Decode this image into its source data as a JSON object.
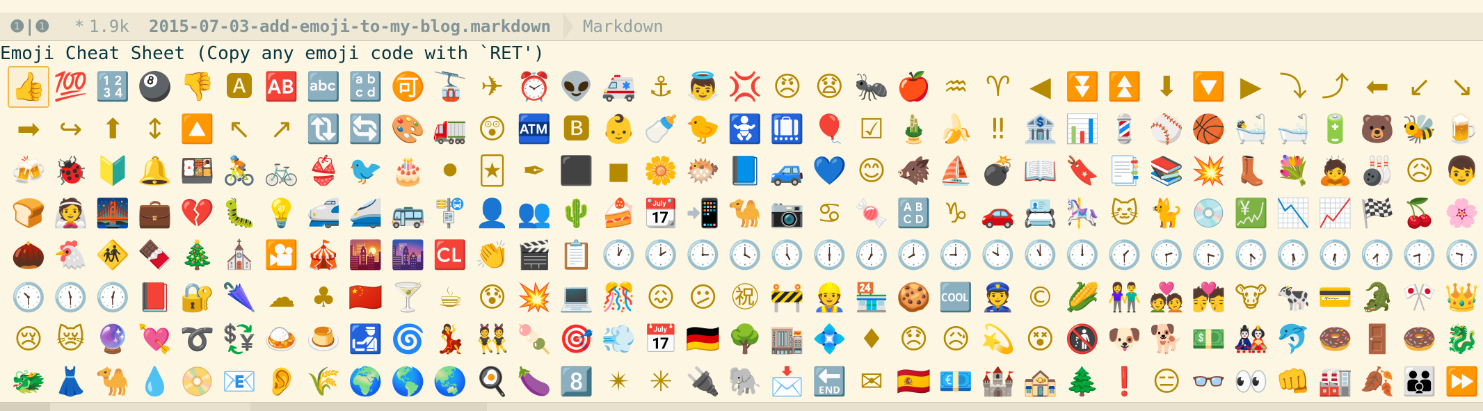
{
  "modeline": {
    "window_numbers": "❶|❶",
    "modified": "*",
    "size": "1.9k",
    "filename": "2015-07-03-add-emoji-to-my-blog.markdown",
    "major_mode": "Markdown"
  },
  "buffer": {
    "title": "Emoji Cheat Sheet (Copy any emoji code with `RET')"
  },
  "emoji_rows": [
    [
      "👍",
      "💯",
      "🔢",
      "🎱",
      "👎",
      "🅰",
      "🆎",
      "🔤",
      "🔡",
      "🉑",
      "🚡",
      "✈",
      "⏰",
      "👽",
      "🚑",
      "⚓",
      "👼",
      "💢",
      "😠",
      "😧",
      "🐜",
      "🍎",
      "♒",
      "♈",
      "◀",
      "⏬",
      "⏫",
      "⬇",
      "🔽",
      "▶",
      "⤵",
      "⤴",
      "⬅",
      "↙",
      "↘"
    ],
    [
      "➡",
      "↪",
      "⬆",
      "↕",
      "🔼",
      "↖",
      "↗",
      "🔃",
      "🔄",
      "🎨",
      "🚛",
      "😲",
      "🏧",
      "🅱",
      "👶",
      "🍼",
      "🐤",
      "🚼",
      "🛄",
      "🎈",
      "☑",
      "🎍",
      "🍌",
      "‼",
      "🏦",
      "📊",
      "💈",
      "⚾",
      "🏀",
      "🛀",
      "🛁",
      "🔋",
      "🐻",
      "🐝",
      "🍺"
    ],
    [
      "🍻",
      "🐞",
      "🔰",
      "🔔",
      "🍱",
      "🚴",
      "🚲",
      "👙",
      "🐦",
      "🎂",
      "⚫",
      "🃏",
      "✒",
      "⬛",
      "◼",
      "🌼",
      "🐡",
      "📘",
      "🚙",
      "💙",
      "😊",
      "🐗",
      "⛵",
      "💣",
      "📖",
      "🔖",
      "📑",
      "📚",
      "💥",
      "👢",
      "💐",
      "🙇",
      "🎳",
      "😥",
      "👦"
    ],
    [
      "🍞",
      "👰",
      "🌉",
      "💼",
      "💔",
      "🐛",
      "💡",
      "🚅",
      "🚄",
      "🚌",
      "🚏",
      "👤",
      "👥",
      "🌵",
      "🍰",
      "📆",
      "📲",
      "🐪",
      "📷",
      "♋",
      "🍬",
      "🔠",
      "♑",
      "🚗",
      "📇",
      "🎠",
      "🐱",
      "🐈",
      "💿",
      "💹",
      "📉",
      "📈",
      "🏁",
      "🍒",
      "🌸"
    ],
    [
      "🌰",
      "🐔",
      "🚸",
      "🍫",
      "🎄",
      "⛪",
      "🎦",
      "🎪",
      "🌇",
      "🌆",
      "🆑",
      "👏",
      "🎬",
      "📋",
      "🕐",
      "🕑",
      "🕒",
      "🕓",
      "🕔",
      "🕕",
      "🕖",
      "🕗",
      "🕘",
      "🕙",
      "🕚",
      "🕛",
      "🕜",
      "🕝",
      "🕞",
      "🕟",
      "🕠",
      "🕡",
      "🕢",
      "🕣",
      "🕤"
    ],
    [
      "🕥",
      "🕦",
      "🕧",
      "📕",
      "🔐",
      "🌂",
      "☁",
      "♣",
      "🇨🇳",
      "🍸",
      "☕",
      "😰",
      "💥",
      "💻",
      "🎊",
      "😖",
      "😕",
      "㊗",
      "🚧",
      "👷",
      "🏪",
      "🍪",
      "🆒",
      "👮",
      "©",
      "🌽",
      "👫",
      "💑",
      "💏",
      "🐮",
      "🐄",
      "💳",
      "🐊",
      "🎌",
      "👑"
    ],
    [
      "😢",
      "😿",
      "🔮",
      "💘",
      "➰",
      "💱",
      "🍛",
      "🍮",
      "🛃",
      "🌀",
      "💃",
      "👯",
      "🍡",
      "🎯",
      "💨",
      "📅",
      "🇩🇪",
      "🌳",
      "🏬",
      "💠",
      "♦",
      "😞",
      "😥",
      "💫",
      "😵",
      "🚯",
      "🐶",
      "🐕",
      "💵",
      "🎎",
      "🐬",
      "🍩",
      "🚪",
      "🍩",
      "🐉"
    ],
    [
      "🐲",
      "👗",
      "🐪",
      "💧",
      "📀",
      "📧",
      "👂",
      "🌾",
      "🌍",
      "🌎",
      "🌏",
      "🍳",
      "🍆",
      "8️⃣",
      "✴",
      "✳",
      "🔌",
      "🐘",
      "📩",
      "🔚",
      "✉",
      "🇪🇸",
      "💶",
      "🏰",
      "🏤",
      "🌲",
      "❗",
      "😑",
      "👓",
      "👀",
      "👊",
      "🏭",
      "🍂",
      "👪",
      "⏩"
    ]
  ],
  "selected": {
    "row": 0,
    "col": 0
  }
}
